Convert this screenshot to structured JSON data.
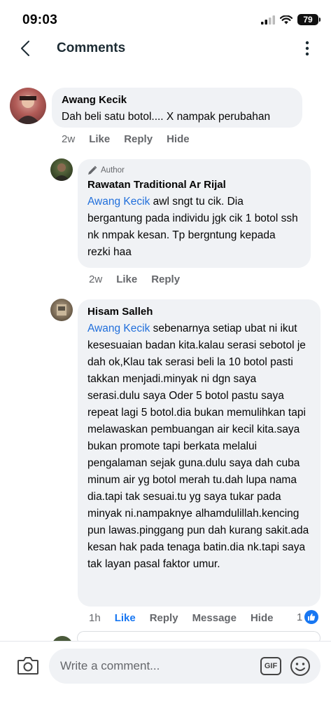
{
  "status_bar": {
    "time": "09:03",
    "battery": "79"
  },
  "header": {
    "title": "Comments"
  },
  "comments": [
    {
      "author": "Awang Kecik",
      "text": "Dah beli satu botol.... X nampak perubahan",
      "time": "2w",
      "actions": [
        "Like",
        "Reply",
        "Hide"
      ]
    },
    {
      "badge": "Author",
      "author": "Rawatan Traditional Ar Rijal",
      "mention": "Awang Kecik",
      "text": " awl sngt tu cik. Dia bergantung pada individu jgk cik 1 botol ssh nk nmpak kesan. Tp bergntung kepada rezki haa",
      "time": "2w",
      "actions": [
        "Like",
        "Reply"
      ]
    },
    {
      "author": "Hisam Salleh",
      "mention": "Awang Kecik",
      "text": " sebenarnya setiap ubat ni ikut kesesuaian badan kita.kalau serasi sebotol je dah ok,Klau tak serasi beli la 10 botol pasti takkan menjadi.minyak ni dgn saya serasi.dulu saya Oder 5 botol pastu saya repeat lagi 5 botol.dia bukan memulihkan tapi melawaskan pembuangan air kecil kita.saya bukan promote tapi berkata melalui pengalaman sejak guna.dulu saya dah cuba minum air yg botol merah tu.dah lupa nama dia.tapi tak sesuai.tu yg saya tukar pada minyak ni.nampaknye alhamdulillah.kencing pun lawas.pinggang pun dah kurang sakit.ada kesan hak pada tenaga batin.dia nk.tapi saya tak layan pasal faktor umur.",
      "time": "1h",
      "actions": [
        "Like",
        "Reply",
        "Message",
        "Hide"
      ],
      "reaction_count": "1"
    }
  ],
  "composer": {
    "placeholder": "Write a comment...",
    "gif_label": "GIF"
  },
  "colors": {
    "link": "#216fdb",
    "liked": "#1877f2",
    "bubble": "#f0f2f5",
    "muted": "#65676b"
  },
  "icons": [
    "back-icon",
    "more-icon",
    "pencil-icon",
    "like-icon",
    "camera-icon",
    "emoji-icon"
  ]
}
